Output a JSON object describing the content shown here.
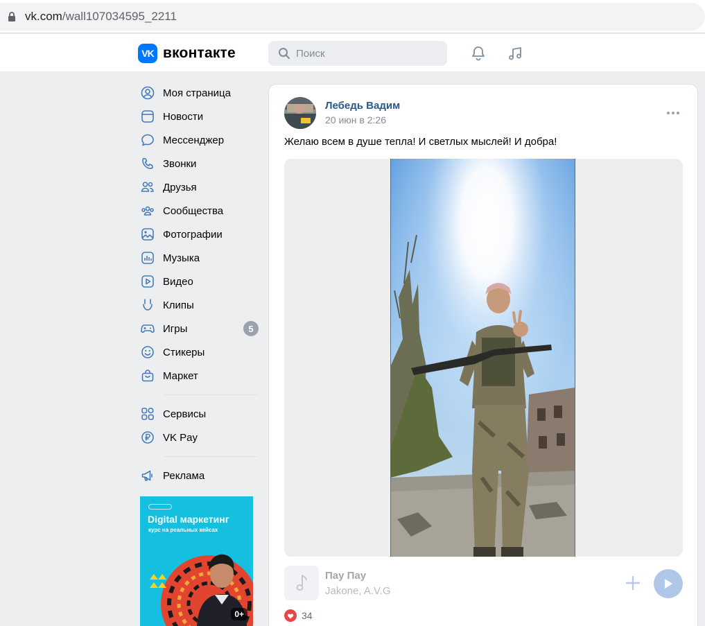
{
  "browser": {
    "domain": "vk.com",
    "path": "/wall107034595_2211"
  },
  "header": {
    "logo_text": "вконтакте",
    "logo_mark": "VK",
    "search_placeholder": "Поиск",
    "accent": "#0077ff"
  },
  "sidebar": {
    "items": [
      {
        "label": "Моя страница",
        "icon": "user-circle-icon"
      },
      {
        "label": "Новости",
        "icon": "news-icon"
      },
      {
        "label": "Мессенджер",
        "icon": "message-icon"
      },
      {
        "label": "Звонки",
        "icon": "phone-icon"
      },
      {
        "label": "Друзья",
        "icon": "friends-icon"
      },
      {
        "label": "Сообщества",
        "icon": "communities-icon"
      },
      {
        "label": "Фотографии",
        "icon": "photos-icon"
      },
      {
        "label": "Музыка",
        "icon": "music-icon"
      },
      {
        "label": "Видео",
        "icon": "video-icon"
      },
      {
        "label": "Клипы",
        "icon": "clips-icon"
      },
      {
        "label": "Игры",
        "icon": "games-icon",
        "badge": "5"
      },
      {
        "label": "Стикеры",
        "icon": "stickers-icon"
      },
      {
        "label": "Маркет",
        "icon": "market-icon"
      }
    ],
    "items2": [
      {
        "label": "Сервисы",
        "icon": "services-icon"
      },
      {
        "label": "VK Pay",
        "icon": "vkpay-icon"
      }
    ],
    "items3": [
      {
        "label": "Реклама",
        "icon": "megaphone-icon"
      }
    ],
    "ad": {
      "title": "Digital маркетинг",
      "subtitle": "курс на реальных кейсах",
      "age": "0+"
    }
  },
  "post": {
    "author": "Лебедь Вадим",
    "date": "20 июн в 2:26",
    "text": "Желаю всем в душе тепла! И светлых мыслей! И добра!",
    "audio": {
      "title": "Пау Пау",
      "artist": "Jakone, A.V.G"
    },
    "likes": "34"
  }
}
